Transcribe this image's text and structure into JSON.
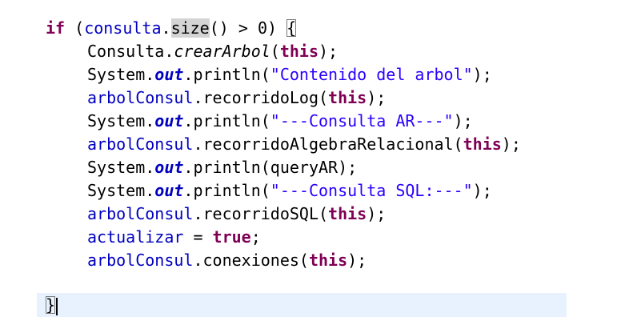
{
  "code": {
    "line1": {
      "kw_if": "if",
      "open": " (",
      "var": "consulta",
      "dot": ".",
      "method": "size",
      "rest": "() > 0) ",
      "brace": "{"
    },
    "line2": {
      "cls": "Consulta.",
      "method": "crearArbol",
      "open": "(",
      "this": "this",
      "close": ");"
    },
    "line3": {
      "cls": "System.",
      "field": "out",
      "method": ".println(",
      "str": "\"Contenido del arbol\"",
      "close": ");"
    },
    "line4": {
      "var": "arbolConsul",
      "method": ".recorridoLog(",
      "this": "this",
      "close": ");"
    },
    "line5": {
      "cls": "System.",
      "field": "out",
      "method": ".println(",
      "str": "\"---Consulta AR---\"",
      "close": ");"
    },
    "line6": {
      "var": "arbolConsul",
      "method": ".recorridoAlgebraRelacional(",
      "this": "this",
      "close": ");"
    },
    "line7": {
      "cls": "System.",
      "field": "out",
      "method": ".println(queryAR);"
    },
    "line8": {
      "cls": "System.",
      "field": "out",
      "method": ".println(",
      "str": "\"---Consulta SQL:---\"",
      "close": ");"
    },
    "line9": {
      "var": "arbolConsul",
      "method": ".recorridoSQL(",
      "this": "this",
      "close": ");"
    },
    "line10": {
      "var": "actualizar",
      "op": " = ",
      "kw_true": "true",
      "close": ";"
    },
    "line11": {
      "var": "arbolConsul",
      "method": ".conexiones(",
      "this": "this",
      "close": ");"
    },
    "line13": {
      "brace": "}"
    }
  },
  "colors": {
    "keyword": "#7f0055",
    "field": "#0000c0",
    "string": "#2a00ff",
    "current_line": "#e8f2fe"
  }
}
